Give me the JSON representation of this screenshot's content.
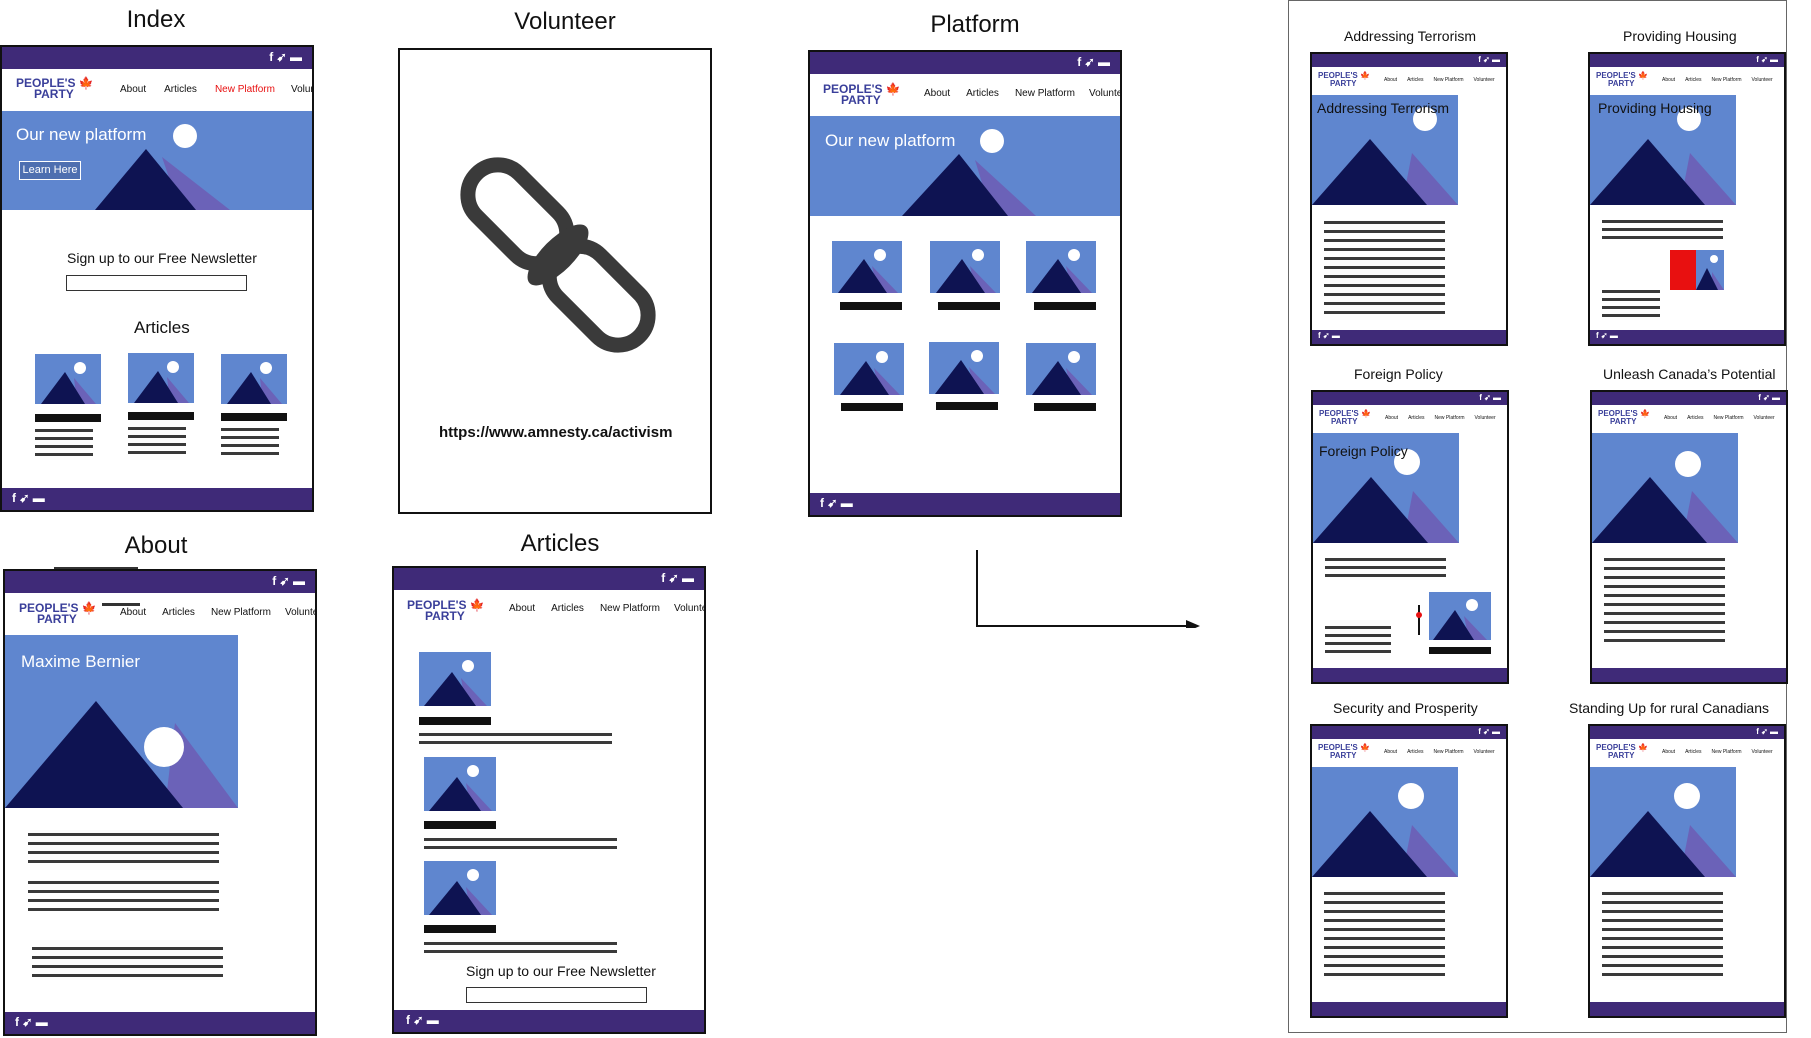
{
  "sections": {
    "index": "Index",
    "volunteer": "Volunteer",
    "platform": "Platform",
    "about": "About",
    "articles": "Articles"
  },
  "nav": {
    "about": "About",
    "articles": "Articles",
    "new_platform": "New Platform",
    "volunteer": "Volunteer"
  },
  "logo": {
    "line1": "PEOPLE'S",
    "line2": "PARTY",
    "leaf": "🍁"
  },
  "social": "f ➹ ▬",
  "index_page": {
    "hero_title": "Our new platform",
    "hero_button": "Learn Here",
    "newsletter_label": "Sign up to our Free Newsletter",
    "articles_heading": "Articles"
  },
  "volunteer_page": {
    "link_icon": "chain-link-icon",
    "url": "https://www.amnesty.ca/activism"
  },
  "platform_page": {
    "hero_title": "Our new platform"
  },
  "about_page": {
    "hero_title": "Maxime Bernier"
  },
  "articles_page": {
    "newsletter_label": "Sign up to our Free Newsletter"
  },
  "platform_articles": {
    "addressing_terrorism": {
      "title": "Addressing Terrorism",
      "hero_title": "Addressing Terrorism"
    },
    "providing_housing": {
      "title": "Providing Housing",
      "hero_title": "Providing Housing"
    },
    "foreign_policy": {
      "title": "Foreign Policy",
      "hero_title": "Foreign Policy"
    },
    "unleash": {
      "title": "Unleash Canada’s Potential"
    },
    "security": {
      "title": "Security and Prosperity"
    },
    "rural": {
      "title": "Standing Up for rural Canadians"
    }
  },
  "colors": {
    "purple_bar": "#3f2a78",
    "hero_blue": "#5f86cf",
    "mountain_dark": "#0e1352",
    "mountain_light": "#6b62b8",
    "accent_red": "#e81010",
    "logo_blue": "#3a3f9a"
  }
}
